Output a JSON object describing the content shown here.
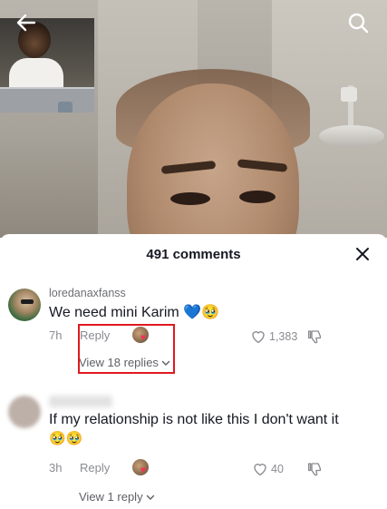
{
  "header": {
    "back_icon": "arrow-left-icon",
    "search_icon": "search-icon"
  },
  "comments_panel": {
    "title": "491 comments",
    "close_icon": "close-icon"
  },
  "comments": [
    {
      "username": "loredanaxfanss",
      "text": "We need mini Karim 💙🥹",
      "time": "7h",
      "reply_label": "Reply",
      "likes": "1,383",
      "view_replies": "View 18 replies",
      "creator_liked": true
    },
    {
      "username": "",
      "text": "If my relationship is not like this I don't want it",
      "emojis": "🥹🥹",
      "time": "3h",
      "reply_label": "Reply",
      "likes": "40",
      "view_replies": "View 1 reply",
      "creator_liked": true
    }
  ],
  "colors": {
    "highlight": "#e0191f",
    "text_primary": "#161823",
    "text_secondary": "#8a8b91",
    "heart": "#fe2c55"
  }
}
